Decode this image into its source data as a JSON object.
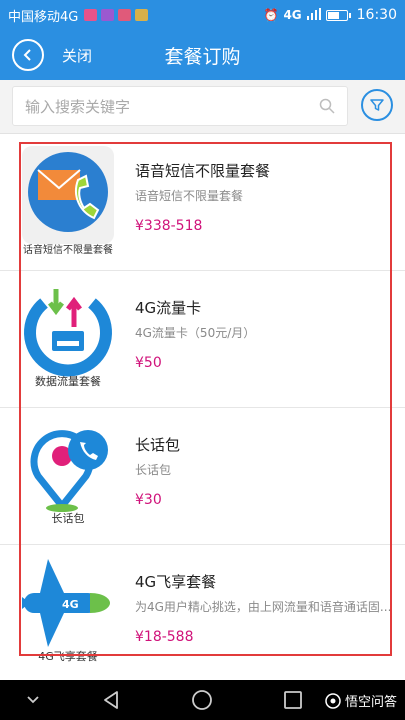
{
  "status_bar": {
    "carrier": "中国移动4G",
    "network": "4G",
    "time": "16:30",
    "battery_level": 0.55
  },
  "header": {
    "close_label": "关闭",
    "title": "套餐订购"
  },
  "search": {
    "placeholder": "输入搜索关键字"
  },
  "packages": [
    {
      "thumb_label": "话音短信不限量套餐",
      "name": "语音短信不限量套餐",
      "desc": "语音短信不限量套餐",
      "price": "¥338-518"
    },
    {
      "thumb_label": "数据流量套餐",
      "name": "4G流量卡",
      "desc": "4G流量卡（50元/月）",
      "price": "¥50"
    },
    {
      "thumb_label": "长话包",
      "name": "长话包",
      "desc": "长话包",
      "price": "¥30"
    },
    {
      "thumb_label": "4G飞享套餐",
      "name": "4G飞享套餐",
      "desc": "为4G用户精心挑选，由上网流量和语音通话固...",
      "price": "¥18-588",
      "plane_text": "4G"
    }
  ],
  "watermark": "悟空问答",
  "colors": {
    "brand": "#2b8fe1",
    "price": "#d0127a",
    "highlight_border": "#e23b3b"
  }
}
